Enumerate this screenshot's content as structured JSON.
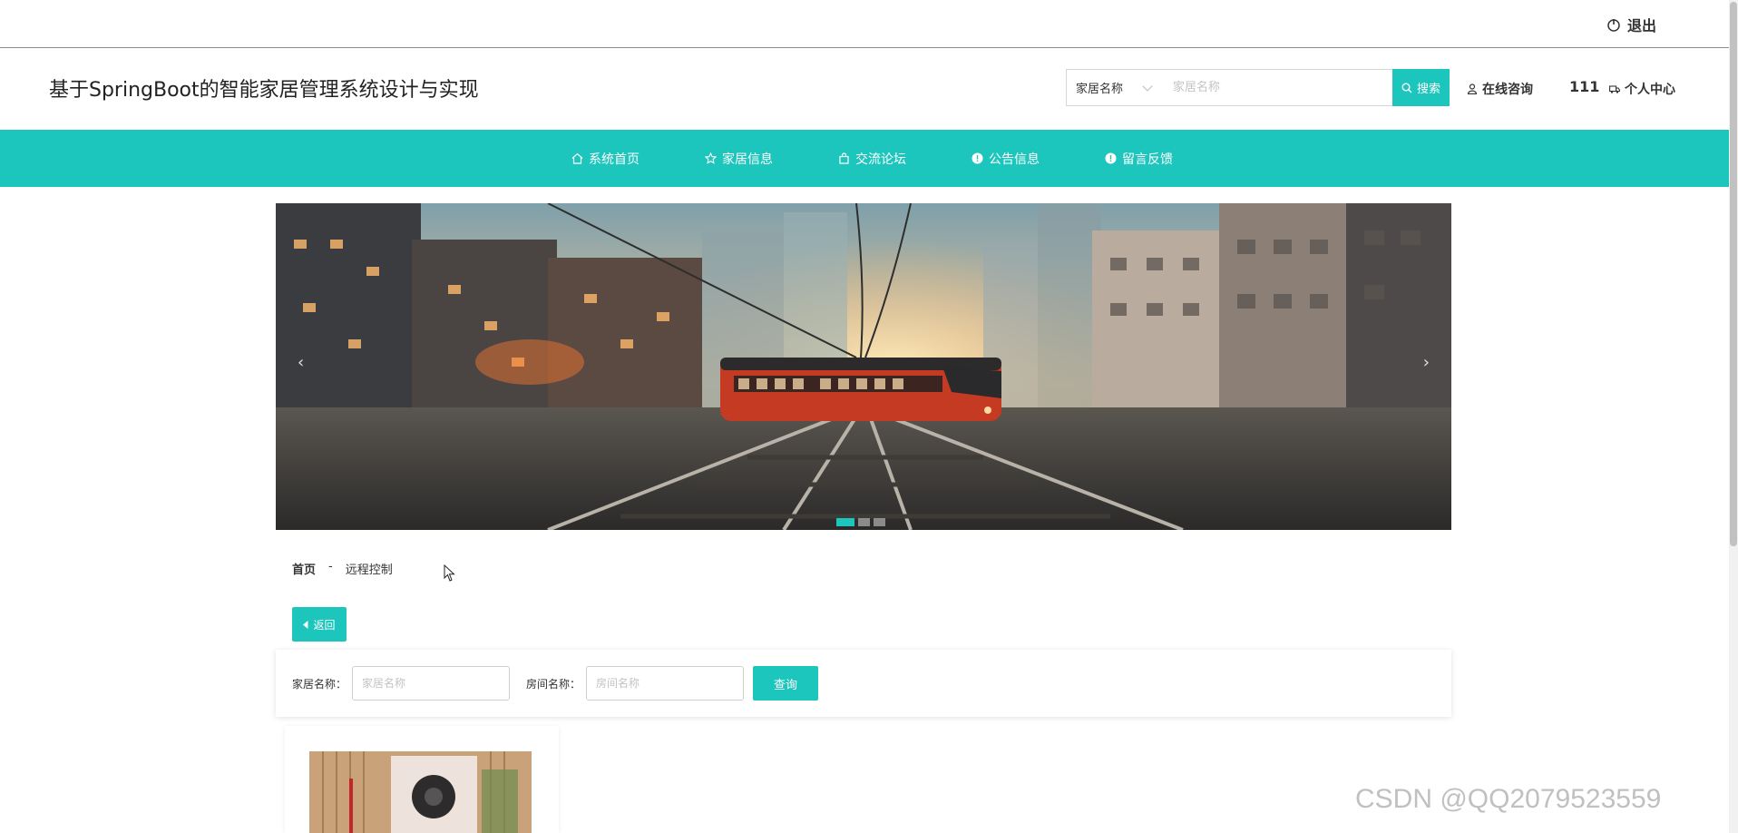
{
  "topbar": {
    "logout_label": "退出"
  },
  "header": {
    "site_title": "基于SpringBoot的智能家居管理系统设计与实现",
    "search": {
      "select_value": "家居名称",
      "placeholder": "家居名称",
      "button_label": "搜索"
    },
    "consult_label": "在线咨询",
    "username": "111",
    "center_label": "个人中心"
  },
  "nav": {
    "items": [
      {
        "label": "系统首页",
        "icon": "home-icon"
      },
      {
        "label": "家居信息",
        "icon": "star-icon"
      },
      {
        "label": "交流论坛",
        "icon": "bag-icon"
      },
      {
        "label": "公告信息",
        "icon": "info-icon"
      },
      {
        "label": "留言反馈",
        "icon": "info-icon"
      }
    ]
  },
  "banner": {
    "prev": "‹",
    "next": "›",
    "slides": 3,
    "active_slide": 1
  },
  "breadcrumb": {
    "home": "首页",
    "separator": "-",
    "current": "远程控制"
  },
  "back_label": "返回",
  "query": {
    "home_label": "家居名称：",
    "home_placeholder": "家居名称",
    "room_label": "房间名称：",
    "room_placeholder": "房间名称",
    "button_label": "查询"
  },
  "watermark": "CSDN @QQ2079523559",
  "colors": {
    "accent": "#1dc6bd"
  }
}
